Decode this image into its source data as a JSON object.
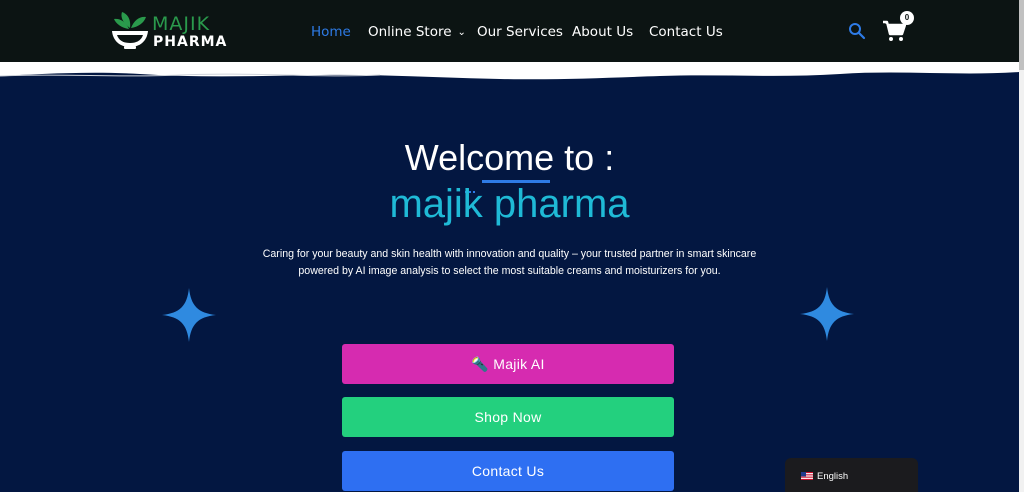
{
  "header": {
    "logo": {
      "line1": "MAJIK",
      "line2": "PHARMA"
    },
    "nav": [
      {
        "label": "Home",
        "active": true
      },
      {
        "label": "Online Store",
        "has_dropdown": true
      },
      {
        "label": "Our Services"
      },
      {
        "label": "About Us"
      },
      {
        "label": "Contact Us"
      }
    ],
    "cart_count": "0",
    "icons": [
      "search-icon",
      "shopping-cart-icon",
      "chevron-down-icon"
    ]
  },
  "hero": {
    "title": "Welcome to :",
    "subtitle": "majik pharma",
    "description": "Caring for your beauty and skin health with innovation and quality – your trusted partner in smart skincare powered by AI image analysis to select the most suitable creams and moisturizers for you."
  },
  "buttons": {
    "ai": "🔦 Majik AI",
    "shop": "Shop Now",
    "contact": "Contact Us"
  },
  "language": {
    "label": "English",
    "flag": "us-flag-icon"
  },
  "colors": {
    "header_bg": "#0c1413",
    "hero_bg": "#031741",
    "accent_blue": "#2e7be6",
    "subtitle_cyan": "#1fbad6",
    "ai_button": "#d62bb0",
    "shop_button": "#23d07e",
    "contact_button": "#2e6ff2"
  }
}
